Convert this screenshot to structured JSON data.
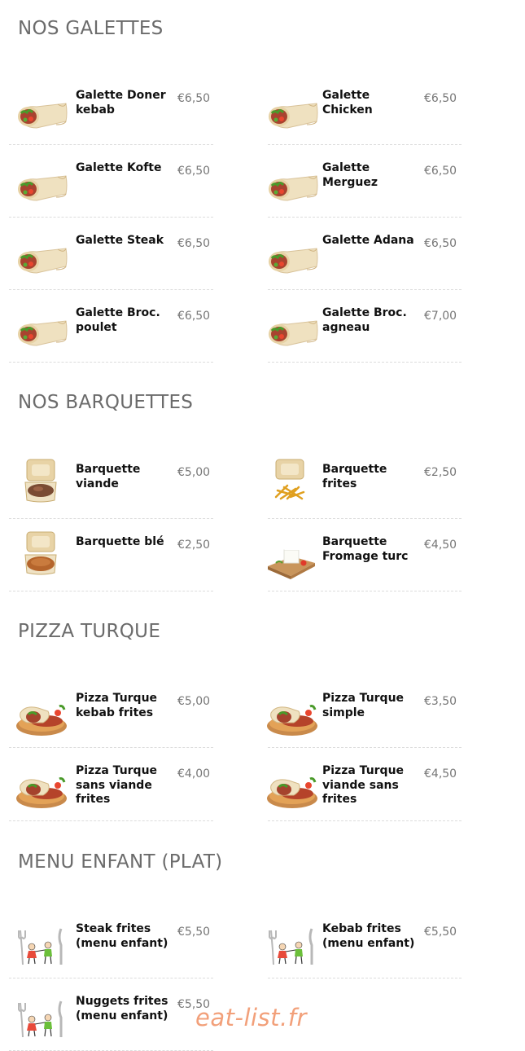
{
  "sections": {
    "galettes": {
      "title": "NOS GALETTES",
      "items": [
        {
          "name": "Galette Doner kebab",
          "price": "€6,50",
          "icon": "wrap-icon"
        },
        {
          "name": "Galette Chicken",
          "price": "€6,50",
          "icon": "wrap-icon"
        },
        {
          "name": "Galette Kofte",
          "price": "€6,50",
          "icon": "wrap-icon"
        },
        {
          "name": "Galette Merguez",
          "price": "€6,50",
          "icon": "wrap-icon"
        },
        {
          "name": "Galette Steak",
          "price": "€6,50",
          "icon": "wrap-icon"
        },
        {
          "name": "Galette Adana",
          "price": "€6,50",
          "icon": "wrap-icon"
        },
        {
          "name": "Galette Broc. poulet",
          "price": "€6,50",
          "icon": "wrap-icon"
        },
        {
          "name": "Galette Broc. agneau",
          "price": "€7,00",
          "icon": "wrap-icon"
        }
      ]
    },
    "barquettes": {
      "title": "NOS BARQUETTES",
      "items": [
        {
          "name": "Barquette viande",
          "price": "€5,00",
          "icon": "meat-box-icon"
        },
        {
          "name": "Barquette frites",
          "price": "€2,50",
          "icon": "fries-box-icon"
        },
        {
          "name": "Barquette blé",
          "price": "€2,50",
          "icon": "bulgur-box-icon"
        },
        {
          "name": "Barquette Fromage turc",
          "price": "€4,50",
          "icon": "cheese-board-icon"
        }
      ]
    },
    "pizza": {
      "title": "PIZZA TURQUE",
      "items": [
        {
          "name": "Pizza Turque kebab frites",
          "price": "€5,00",
          "icon": "pizza-plate-icon"
        },
        {
          "name": "Pizza Turque simple",
          "price": "€3,50",
          "icon": "pizza-plate-icon"
        },
        {
          "name": "Pizza Turque sans viande frites",
          "price": "€4,00",
          "icon": "pizza-plate-icon"
        },
        {
          "name": "Pizza Turque viande sans frites",
          "price": "€4,50",
          "icon": "pizza-plate-icon"
        }
      ]
    },
    "enfant": {
      "title": "MENU ENFANT (PLAT)",
      "items": [
        {
          "name": "Steak frites (menu enfant)",
          "price": "€5,50",
          "icon": "kids-menu-icon"
        },
        {
          "name": "Kebab frites (menu enfant)",
          "price": "€5,50",
          "icon": "kids-menu-icon"
        },
        {
          "name": "Nuggets frites (menu enfant)",
          "price": "€5,50",
          "icon": "kids-menu-icon"
        }
      ]
    }
  },
  "watermark": "eat-list.fr",
  "colors": {
    "section_title": "#6b6b6b",
    "price": "#777777",
    "watermark": "#f2a07a",
    "divider": "#dcdcdc"
  }
}
